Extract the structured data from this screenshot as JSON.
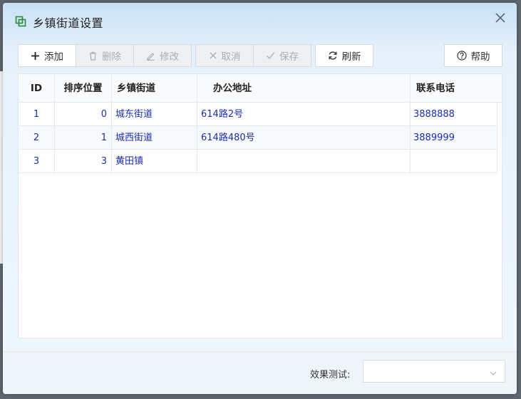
{
  "dialog": {
    "title": "乡镇街道设置",
    "accent_color": "#2a8a3a"
  },
  "toolbar": {
    "add_label": "添加",
    "delete_label": "删除",
    "edit_label": "修改",
    "cancel_label": "取消",
    "save_label": "保存",
    "refresh_label": "刷新",
    "help_label": "帮助"
  },
  "grid": {
    "columns": [
      "ID",
      "排序位置",
      "乡镇街道",
      "办公地址",
      "联系电话"
    ],
    "rows": [
      {
        "id": "1",
        "order": "0",
        "name": "城东街道",
        "address": "614路2号",
        "phone": "3888888"
      },
      {
        "id": "2",
        "order": "1",
        "name": "城西街道",
        "address": "614路480号",
        "phone": "3889999"
      },
      {
        "id": "3",
        "order": "3",
        "name": "黄田镇",
        "address": "",
        "phone": ""
      }
    ]
  },
  "footer": {
    "test_label": "效果测试:",
    "test_value": ""
  }
}
